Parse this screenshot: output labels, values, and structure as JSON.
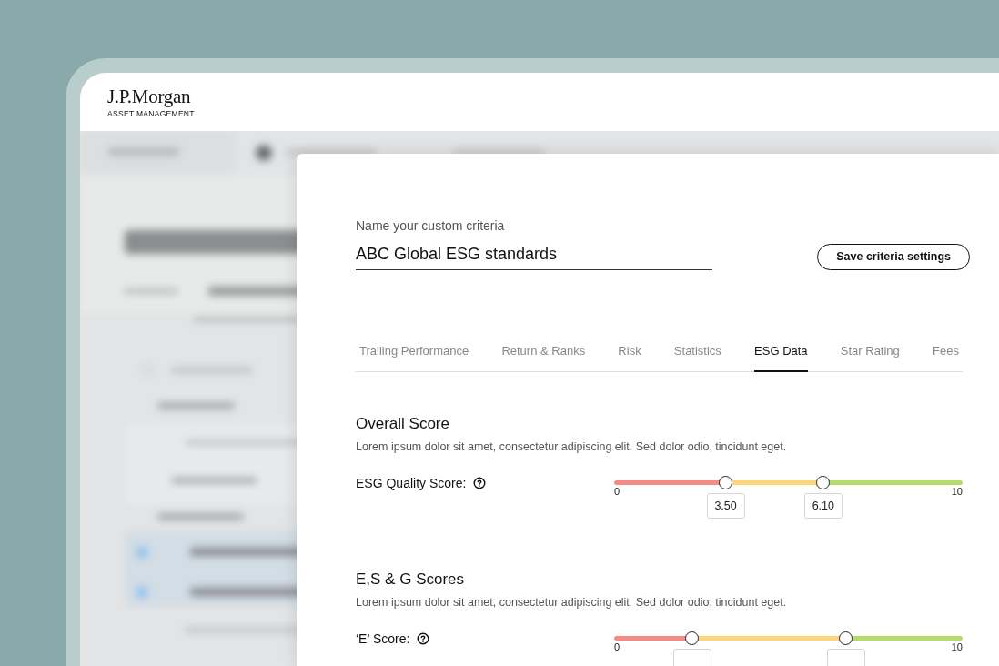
{
  "logo": {
    "wordmark": "J.P.Morgan",
    "subtitle": "ASSET MANAGEMENT"
  },
  "criteria_name": {
    "label": "Name your custom criteria",
    "value": "ABC Global ESG standards"
  },
  "save_button": "Save criteria settings",
  "tabs": [
    {
      "label": "Trailing Performance",
      "selected": false
    },
    {
      "label": "Return & Ranks",
      "selected": false
    },
    {
      "label": "Risk",
      "selected": false
    },
    {
      "label": "Statistics",
      "selected": false
    },
    {
      "label": "ESG Data",
      "selected": true
    },
    {
      "label": "Star Rating",
      "selected": false
    },
    {
      "label": "Fees",
      "selected": false
    }
  ],
  "sections": [
    {
      "title": "Overall Score",
      "description": "Lorem ipsum dolor sit amet, consectetur adipiscing elit. Sed dolor odio, tincidunt eget.",
      "sliders": [
        {
          "label": "ESG Quality Score:",
          "min": "0",
          "max": "10",
          "thumbs": [
            {
              "level": 0.32,
              "reading": "3.50"
            },
            {
              "level": 0.6,
              "reading": "6.10"
            }
          ]
        }
      ]
    },
    {
      "title": "E,S & G Scores",
      "description": "Lorem ipsum dolor sit amet, consectetur adipiscing elit. Sed dolor odio, tincidunt eget.",
      "sliders": [
        {
          "label": "‘E’ Score:",
          "min": "0",
          "max": "10",
          "thumbs": [
            {
              "level": 0.225
            },
            {
              "level": 0.665
            }
          ]
        }
      ]
    }
  ]
}
